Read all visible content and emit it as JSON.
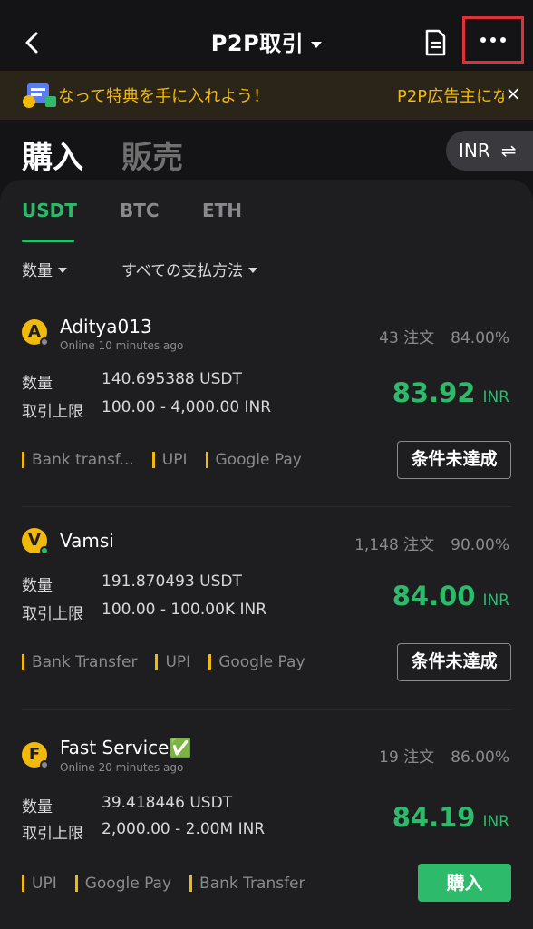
{
  "header": {
    "title": "P2P取引"
  },
  "banner": {
    "text": "なって特典を手に入れよう！",
    "text2": "P2P広告主にな",
    "close": "×"
  },
  "mode": {
    "buy": "購入",
    "sell": "販売",
    "fiat": "INR",
    "swap": "⇌"
  },
  "tabs": [
    "USDT",
    "BTC",
    "ETH"
  ],
  "filters": {
    "amount": "数量",
    "payment": "すべての支払方法"
  },
  "labels": {
    "quantity": "数量",
    "limit": "取引上限",
    "orders_suffix": "注文"
  },
  "ads": [
    {
      "initial": "A",
      "name": "Aditya013",
      "online": "Online 10 minutes ago",
      "orders": "43 注文",
      "completion": "84.00%",
      "quantity": "140.695388 USDT",
      "limit": "100.00 - 4,000.00 INR",
      "price": "83.92",
      "currency": "INR",
      "methods": [
        "Bank transf...",
        "UPI",
        "Google Pay"
      ],
      "action": "条件未達成",
      "status_color": "#8a8a8e"
    },
    {
      "initial": "V",
      "name": "Vamsi",
      "online": "",
      "orders": "1,148 注文",
      "completion": "90.00%",
      "quantity": "191.870493 USDT",
      "limit": "100.00 - 100.00K INR",
      "price": "84.00",
      "currency": "INR",
      "methods": [
        "Bank Transfer",
        "UPI",
        "Google Pay"
      ],
      "action": "条件未達成",
      "status_color": "#2eba6b"
    },
    {
      "initial": "F",
      "name": "Fast Service✅",
      "online": "Online 20 minutes ago",
      "orders": "19 注文",
      "completion": "86.00%",
      "quantity": "39.418446 USDT",
      "limit": "2,000.00 - 2.00M INR",
      "price": "84.19",
      "currency": "INR",
      "methods": [
        "UPI",
        "Google Pay",
        "Bank Transfer"
      ],
      "action": "購入",
      "status_color": "#8a8a8e"
    }
  ],
  "colors": {
    "accent": "#2eba6b",
    "brand": "#f0b90b",
    "highlight": "#e0303a"
  }
}
